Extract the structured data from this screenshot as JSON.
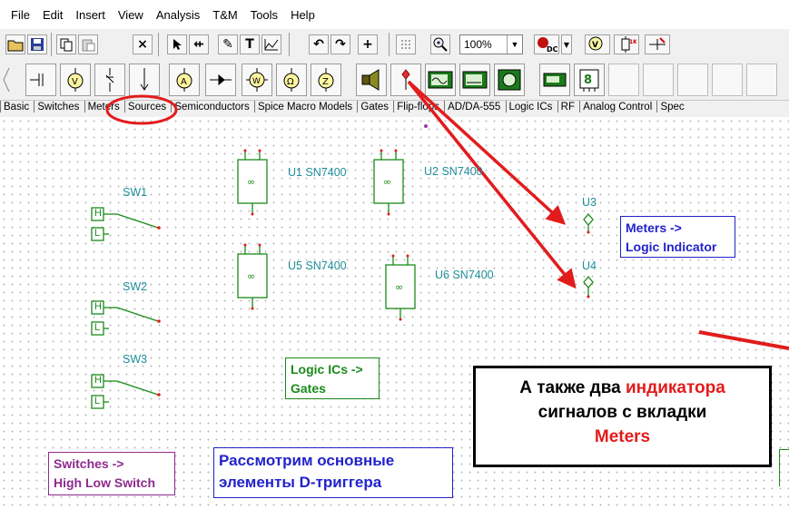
{
  "menu": [
    "File",
    "Edit",
    "Insert",
    "View",
    "Analysis",
    "T&M",
    "Tools",
    "Help"
  ],
  "toolbar": {
    "zoom": "100%",
    "buttons": [
      "open-folder-icon",
      "save-icon",
      "copy-icon",
      "paste-icon",
      "delete-icon",
      "select-icon",
      "wire-icon",
      "pencil-icon",
      "text-icon",
      "graph-icon",
      "undo-icon",
      "redo-icon",
      "junction-icon",
      "grid-icon",
      "zoom-icon",
      "dc-source-icon",
      "voltmeter-icon",
      "resistor-icon",
      "probe-icon"
    ]
  },
  "component_toolbar": [
    "capacitor-icon",
    "voltmeter-icon",
    "switch-icon",
    "ground-icon",
    "ammeter-icon",
    "diode-icon",
    "wattmeter-icon",
    "ohmmeter-icon",
    "impedance-meter-icon",
    "speaker-icon",
    "logic-indicator-icon",
    "oscilloscope-icon",
    "signal-analyzer-icon",
    "logic-analyzer-icon",
    "multimeter-icon",
    "counter-icon"
  ],
  "tabs": [
    "Basic",
    "Switches",
    "Meters",
    "Sources",
    "Semiconductors",
    "Spice Macro Models",
    "Gates",
    "Flip-flops",
    "AD/DA-555",
    "Logic ICs",
    "RF",
    "Analog Control",
    "Spec"
  ],
  "schematic": {
    "switches": [
      {
        "name": "SW1",
        "high": "H",
        "low": "L"
      },
      {
        "name": "SW2",
        "high": "H",
        "low": "L"
      },
      {
        "name": "SW3",
        "high": "H",
        "low": "L"
      }
    ],
    "gates": [
      "U1 SN7400",
      "U2 SN7400",
      "U5 SN7400",
      "U6 SN7400"
    ],
    "indicators": [
      "U3",
      "U4"
    ]
  },
  "notes": {
    "meters": [
      "Meters ->",
      "Logic Indicator"
    ],
    "logic_ics": [
      "Logic ICs ->",
      "Gates"
    ],
    "switches": [
      "Switches ->",
      "High Low Switch"
    ],
    "title": [
      "Рассмотрим основные",
      "элементы D-триггера"
    ]
  },
  "callout": {
    "line1_a": "А также два ",
    "line1_b": "индикатора",
    "line2": "сигналов с вкладки",
    "line3": "Meters"
  },
  "colors": {
    "schematic_green": "#1a8a1a",
    "label_teal": "#1f8f9a",
    "annotation_red": "#e21c1c",
    "meters_note_border": "#2222cc",
    "logic_note_border": "#1a8a1a",
    "switches_note_border": "#8e2a8e"
  }
}
